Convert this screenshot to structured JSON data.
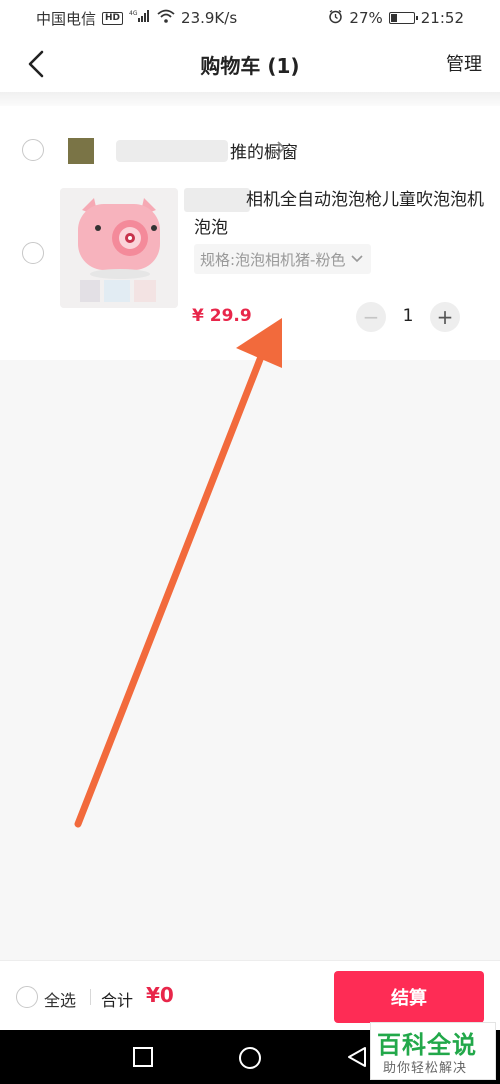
{
  "status_bar": {
    "carrier": "中国电信",
    "network_badge": "HD",
    "network_type": "4G",
    "speed": "23.9K/s",
    "battery_percent": "27%",
    "battery_level": 0.27,
    "time": "21:52"
  },
  "nav": {
    "title": "购物车 (1)",
    "manage_label": "管理"
  },
  "shop": {
    "name_visible": "推的橱窗"
  },
  "item": {
    "title": "相机全自动泡泡枪儿童吹泡泡机泡泡",
    "spec": "规格:泡泡相机猪-粉色",
    "price": "¥ 29.9",
    "quantity": "1",
    "minus_label": "−",
    "plus_label": "+"
  },
  "bottom_bar": {
    "select_all_label": "全选",
    "total_label": "合计",
    "total_value": "¥0",
    "checkout_label": "结算"
  },
  "watermark": {
    "title": "百科全说",
    "subtitle": "助你轻松解决"
  },
  "colors": {
    "accent": "#fe2c55",
    "price": "#e8264a",
    "arrow": "#f26a3c",
    "watermark_green": "#22a84a"
  }
}
